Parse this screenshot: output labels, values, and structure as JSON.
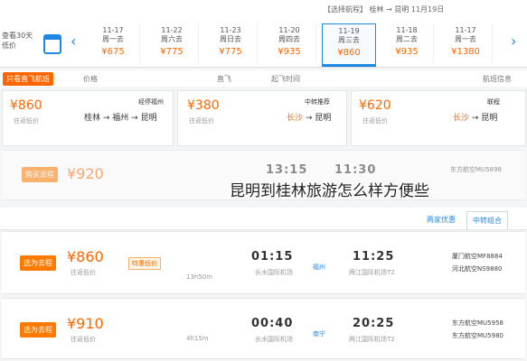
{
  "breadcrumb": "【选择航程】 桂林 → 昆明 11月19日",
  "calendar": {
    "label1": "查看30天",
    "label2": "低价"
  },
  "dates": [
    {
      "d1": "11-17",
      "d2": "周一去",
      "price": "¥675"
    },
    {
      "d1": "11-22",
      "d2": "周六去",
      "price": "¥775"
    },
    {
      "d1": "11-23",
      "d2": "周日去",
      "price": "¥775"
    },
    {
      "d1": "11-20",
      "d2": "周四去",
      "price": "¥935"
    },
    {
      "d1": "11-19",
      "d2": "周三去",
      "price": "¥860"
    },
    {
      "d1": "11-18",
      "d2": "周二去",
      "price": "¥935"
    },
    {
      "d1": "11-17",
      "d2": "周一去",
      "price": "¥1380"
    }
  ],
  "filters": {
    "tag": "只看直飞航班",
    "price": "价格",
    "depart": "起飞时间",
    "direct": "直飞",
    "info": "航班信息"
  },
  "cards": [
    {
      "price": "¥860",
      "sub": "往返低价",
      "from": "桂林",
      "via": "福州",
      "to": "昆明",
      "note": "经停福州"
    },
    {
      "price": "¥380",
      "sub": "往返低价",
      "from": "长沙",
      "to": "昆明",
      "note": "中转推荐"
    },
    {
      "price": "¥620",
      "sub": "往返低价",
      "from": "长沙",
      "to": "昆明",
      "note": "联程"
    }
  ],
  "row1": {
    "price": "¥920",
    "btn": "购买去程",
    "dep": "11:30",
    "arr": "13:15",
    "airline": "东方航空MU5898"
  },
  "tabs": {
    "active": "中转组合",
    "other": "两家优惠"
  },
  "row2": {
    "price": "¥860",
    "sub": "往返低价",
    "btn": "选为去程",
    "tag": "特惠低价",
    "dep": "11:25",
    "arr": "01:15",
    "via": "经停",
    "dep_ap": "两江国际机场T2",
    "arr_ap": "长水国际机场",
    "airline1": "厦门航空MF8884",
    "airline2": "河北航空NS9880",
    "dur": "13h50m",
    "stop": "福州"
  },
  "row3": {
    "price": "¥910",
    "sub": "往返低价",
    "btn": "选为去程",
    "dep": "20:25",
    "arr": "00:40",
    "dep_ap": "两江国际机场T2",
    "arr_ap": "长水国际机场",
    "airline1": "东方航空MU5958",
    "airline2": "东方航空MU5980",
    "dur": "4h15m",
    "stop": "南宁"
  },
  "overlay": "昆明到桂林旅游怎么样方便些"
}
